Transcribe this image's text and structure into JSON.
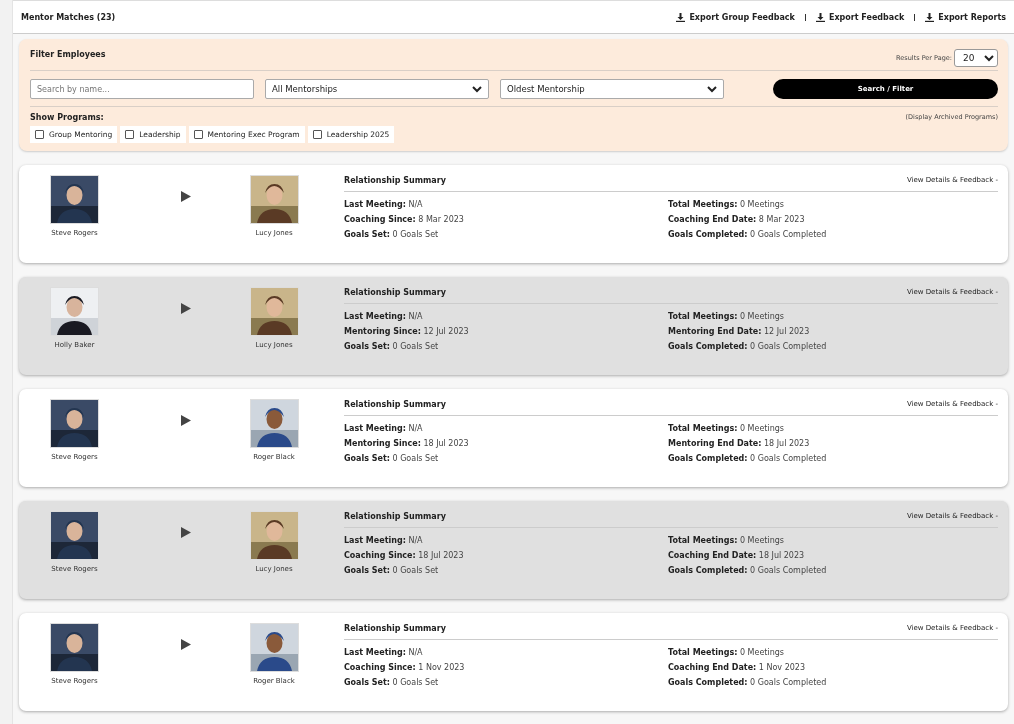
{
  "header": {
    "title": "Mentor Matches (23)",
    "exports": [
      "Export Group Feedback",
      "Export Feedback",
      "Export Reports"
    ]
  },
  "filter": {
    "title": "Filter Employees",
    "results_label": "Results Per Page:",
    "results_value": "20",
    "search": {
      "placeholder": "Search by name..."
    },
    "mentorship_select": "All Mentorships",
    "order_select": "Oldest Mentorship",
    "button": "Search / Filter",
    "programs_label": "Show Programs:",
    "archived_link": "(Display Archived Programs)",
    "programs": [
      {
        "label": "Group Mentoring",
        "checked": false
      },
      {
        "label": "Leadership",
        "checked": false
      },
      {
        "label": "Mentoring Exec Program",
        "checked": false
      },
      {
        "label": "Leadership 2025",
        "checked": false
      }
    ]
  },
  "matches": [
    {
      "shaded": false,
      "mentor": "Steve Rogers",
      "mentee": "Lucy Jones",
      "summary_title": "Relationship Summary",
      "details_link": "View Details & Feedback -",
      "left": [
        [
          "Last Meeting:",
          "N/A"
        ],
        [
          "Coaching Since:",
          "8 Mar 2023"
        ],
        [
          "Goals Set:",
          "0 Goals Set"
        ]
      ],
      "right": [
        [
          "Total Meetings:",
          "0 Meetings"
        ],
        [
          "Coaching End Date:",
          "8 Mar 2023"
        ],
        [
          "Goals Completed:",
          "0 Goals Completed"
        ]
      ]
    },
    {
      "shaded": true,
      "mentor": "Holly Baker",
      "mentee": "Lucy Jones",
      "summary_title": "Relationship Summary",
      "details_link": "View Details & Feedback -",
      "left": [
        [
          "Last Meeting:",
          "N/A"
        ],
        [
          "Mentoring Since:",
          "12 Jul 2023"
        ],
        [
          "Goals Set:",
          "0 Goals Set"
        ]
      ],
      "right": [
        [
          "Total Meetings:",
          "0 Meetings"
        ],
        [
          "Mentoring End Date:",
          "12 Jul 2023"
        ],
        [
          "Goals Completed:",
          "0 Goals Completed"
        ]
      ]
    },
    {
      "shaded": false,
      "mentor": "Steve Rogers",
      "mentee": "Roger Black",
      "summary_title": "Relationship Summary",
      "details_link": "View Details & Feedback -",
      "left": [
        [
          "Last Meeting:",
          "N/A"
        ],
        [
          "Mentoring Since:",
          "18 Jul 2023"
        ],
        [
          "Goals Set:",
          "0 Goals Set"
        ]
      ],
      "right": [
        [
          "Total Meetings:",
          "0 Meetings"
        ],
        [
          "Mentoring End Date:",
          "18 Jul 2023"
        ],
        [
          "Goals Completed:",
          "0 Goals Completed"
        ]
      ]
    },
    {
      "shaded": true,
      "mentor": "Steve Rogers",
      "mentee": "Lucy Jones",
      "summary_title": "Relationship Summary",
      "details_link": "View Details & Feedback -",
      "left": [
        [
          "Last Meeting:",
          "N/A"
        ],
        [
          "Coaching Since:",
          "18 Jul 2023"
        ],
        [
          "Goals Set:",
          "0 Goals Set"
        ]
      ],
      "right": [
        [
          "Total Meetings:",
          "0 Meetings"
        ],
        [
          "Coaching End Date:",
          "18 Jul 2023"
        ],
        [
          "Goals Completed:",
          "0 Goals Completed"
        ]
      ]
    },
    {
      "shaded": false,
      "mentor": "Steve Rogers",
      "mentee": "Roger Black",
      "summary_title": "Relationship Summary",
      "details_link": "View Details & Feedback -",
      "left": [
        [
          "Last Meeting:",
          "N/A"
        ],
        [
          "Coaching Since:",
          "1 Nov 2023"
        ],
        [
          "Goals Set:",
          "0 Goals Set"
        ]
      ],
      "right": [
        [
          "Total Meetings:",
          "0 Meetings"
        ],
        [
          "Coaching End Date:",
          "1 Nov 2023"
        ],
        [
          "Goals Completed:",
          "0 Goals Completed"
        ]
      ]
    }
  ]
}
